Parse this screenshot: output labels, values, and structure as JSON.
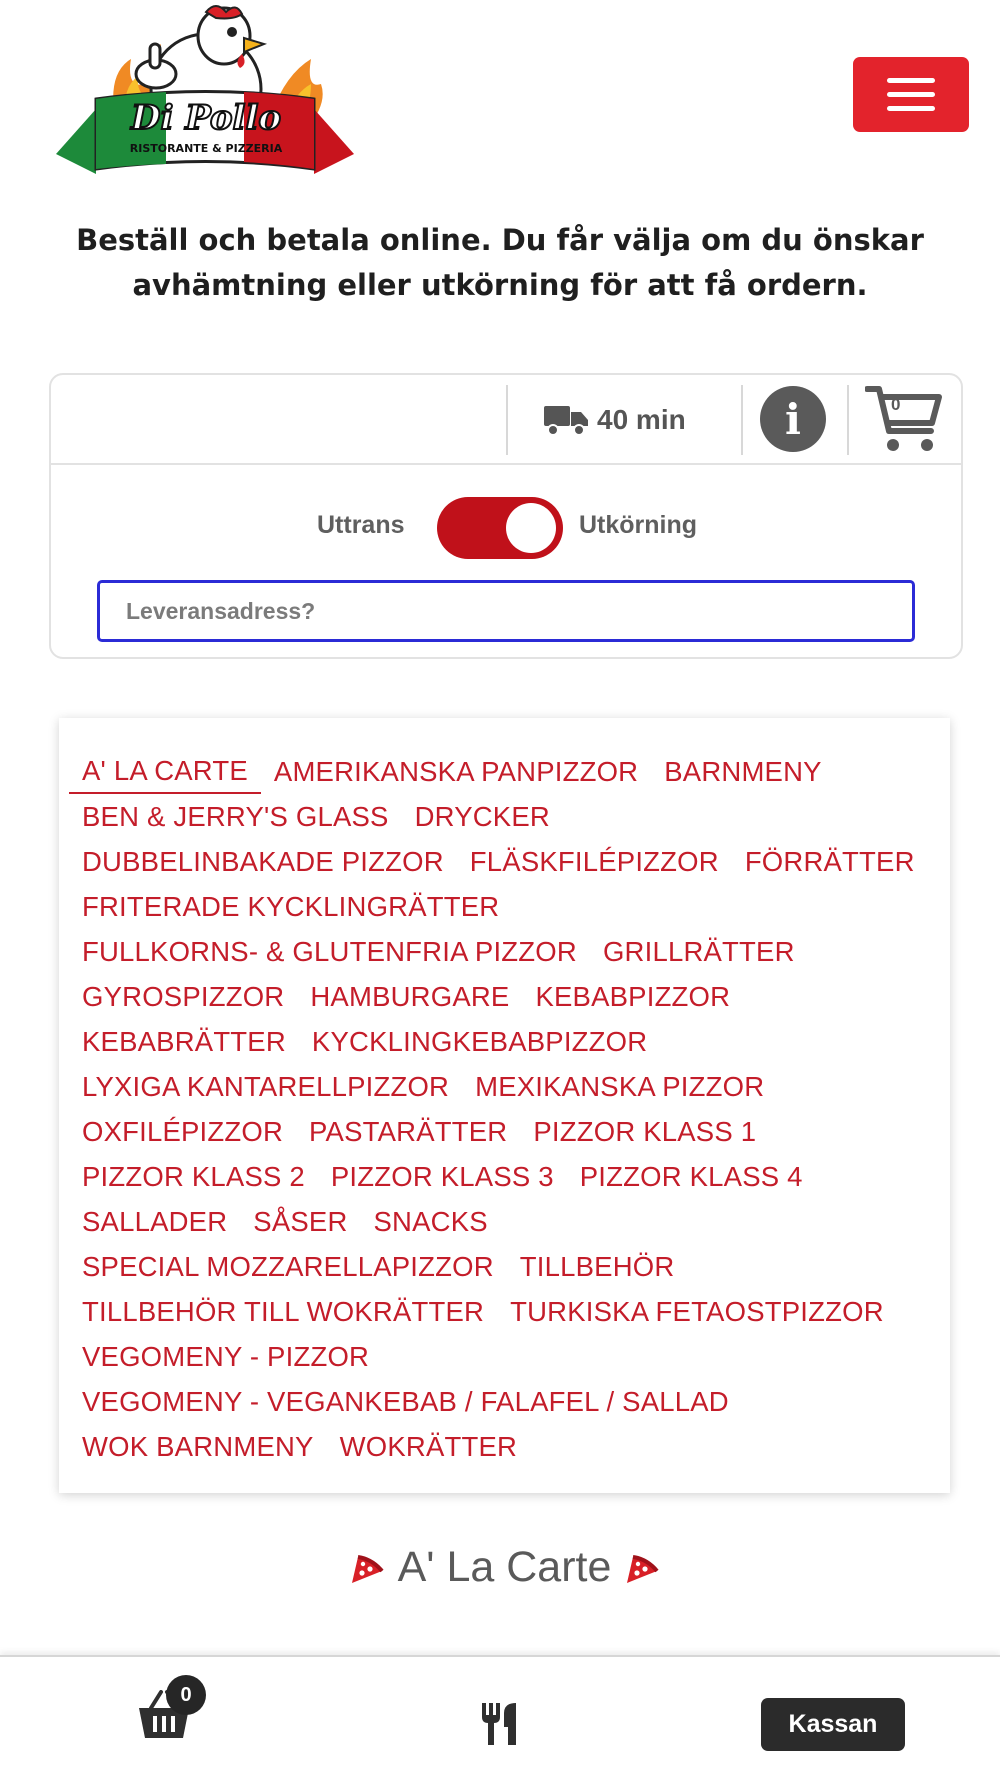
{
  "header": {
    "logo": {
      "name": "Di Pollo",
      "subtitle": "RISTORANTE & PIZZERIA"
    },
    "menu_icon": "hamburger-menu-icon"
  },
  "intro_text": "Beställ och betala online. Du får välja om du önskar avhämtning eller utkörning för att få ordern.",
  "order_panel": {
    "delivery_time": "40 min",
    "delivery_icon": "truck-icon",
    "info_icon": "info-icon",
    "cart_icon": "cart-icon",
    "cart_count": "0",
    "toggle_left_label": "Uttrans",
    "toggle_right_label": "Utkörning",
    "toggle_state": "Utkörning",
    "address_placeholder": "Leveransadress?"
  },
  "categories": [
    [
      "A' LA CARTE",
      "AMERIKANSKA PANPIZZOR",
      "BARNMENY"
    ],
    [
      "BEN & JERRY'S GLASS",
      "DRYCKER"
    ],
    [
      "DUBBELINBAKADE PIZZOR",
      "FLÄSKFILÉPIZZOR",
      "FÖRRÄTTER"
    ],
    [
      "FRITERADE KYCKLINGRÄTTER"
    ],
    [
      "FULLKORNS- & GLUTENFRIA PIZZOR",
      "GRILLRÄTTER"
    ],
    [
      "GYROSPIZZOR",
      "HAMBURGARE",
      "KEBABPIZZOR"
    ],
    [
      "KEBABRÄTTER",
      "KYCKLINGKEBABPIZZOR"
    ],
    [
      "LYXIGA KANTARELLPIZZOR",
      "MEXIKANSKA PIZZOR"
    ],
    [
      "OXFILÉPIZZOR",
      "PASTARÄTTER",
      "PIZZOR KLASS 1"
    ],
    [
      "PIZZOR KLASS 2",
      "PIZZOR KLASS 3",
      "PIZZOR KLASS 4"
    ],
    [
      "SALLADER",
      "SÅSER",
      "SNACKS"
    ],
    [
      "SPECIAL MOZZARELLAPIZZOR",
      "TILLBEHÖR"
    ],
    [
      "TILLBEHÖR TILL WOKRÄTTER",
      "TURKISKA FETAOSTPIZZOR"
    ],
    [
      "VEGOMENY - PIZZOR"
    ],
    [
      "VEGOMENY - VEGANKEBAB / FALAFEL / SALLAD"
    ],
    [
      "WOK BARNMENY",
      "WOKRÄTTER"
    ]
  ],
  "active_category": "A' LA CARTE",
  "section_title": "A' La Carte",
  "section_icon": "pizza-slice-icon",
  "bottom_bar": {
    "basket_icon": "basket-icon",
    "basket_count": "0",
    "menu_icon": "cutlery-icon",
    "checkout_label": "Kassan"
  },
  "colors": {
    "brand_red": "#e3232c",
    "category_red": "#c41d2a",
    "toggle_red": "#c0111a",
    "focus_blue": "#2b2bd6",
    "dark_button": "#2b2b2b"
  }
}
